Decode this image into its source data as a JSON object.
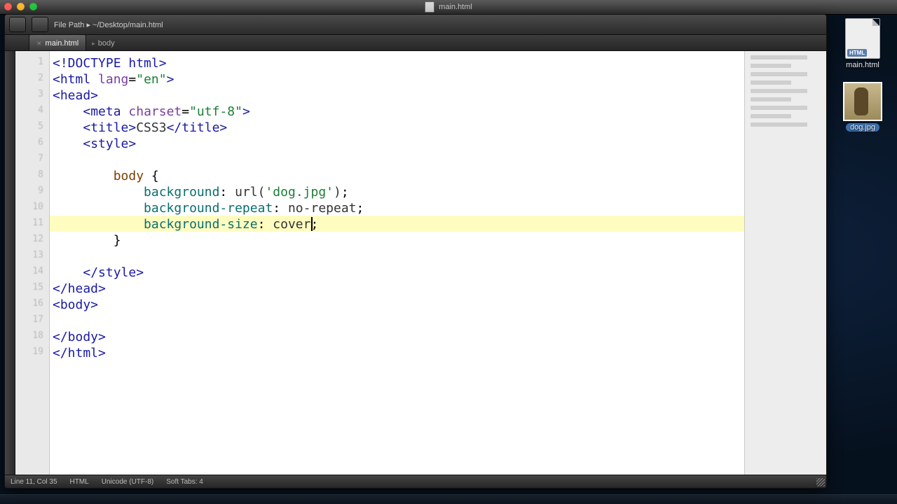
{
  "menubar": {
    "title": "main.html"
  },
  "window": {
    "path": "File Path ▸ ~/Desktop/main.html",
    "tab": "main.html",
    "breadcrumb": "body",
    "status": {
      "line_col": "Line 11, Col 35",
      "mode": "HTML",
      "encoding": "Unicode (UTF-8)",
      "indent": "Soft Tabs: 4"
    }
  },
  "code": {
    "lines": [
      {
        "n": 1,
        "seg": [
          [
            "t-tag",
            "<!DOCTYPE html>"
          ]
        ]
      },
      {
        "n": 2,
        "seg": [
          [
            "t-tag",
            "<html "
          ],
          [
            "t-attr",
            "lang"
          ],
          [
            "t-punct",
            "="
          ],
          [
            "t-str",
            "\"en\""
          ],
          [
            "t-tag",
            ">"
          ]
        ]
      },
      {
        "n": 3,
        "seg": [
          [
            "t-tag",
            "<head>"
          ]
        ]
      },
      {
        "n": 4,
        "indent": 1,
        "seg": [
          [
            "t-tag",
            "<meta "
          ],
          [
            "t-attr",
            "charset"
          ],
          [
            "t-punct",
            "="
          ],
          [
            "t-str",
            "\"utf-8\""
          ],
          [
            "t-tag",
            ">"
          ]
        ]
      },
      {
        "n": 5,
        "indent": 1,
        "seg": [
          [
            "t-tag",
            "<title>"
          ],
          [
            "t-val",
            "CSS3"
          ],
          [
            "t-tag",
            "</title>"
          ]
        ]
      },
      {
        "n": 6,
        "indent": 1,
        "seg": [
          [
            "t-tag",
            "<style>"
          ]
        ]
      },
      {
        "n": 7,
        "blank": true
      },
      {
        "n": 8,
        "indent": 2,
        "seg": [
          [
            "t-sel",
            "body "
          ],
          [
            "t-punct",
            "{"
          ]
        ]
      },
      {
        "n": 9,
        "indent": 3,
        "seg": [
          [
            "t-prop",
            "background"
          ],
          [
            "t-punct",
            ": "
          ],
          [
            "t-val",
            "url("
          ],
          [
            "t-str",
            "'dog.jpg'"
          ],
          [
            "t-val",
            ")"
          ],
          [
            "t-punct",
            ";"
          ]
        ]
      },
      {
        "n": 10,
        "indent": 3,
        "seg": [
          [
            "t-prop",
            "background-repeat"
          ],
          [
            "t-punct",
            ": "
          ],
          [
            "t-val",
            "no-repeat"
          ],
          [
            "t-punct",
            ";"
          ]
        ]
      },
      {
        "n": 11,
        "indent": 3,
        "hl": true,
        "caret_after": "cover",
        "seg": [
          [
            "t-prop",
            "background-size"
          ],
          [
            "t-punct",
            ": "
          ],
          [
            "t-val",
            "cover"
          ],
          [
            "t-punct",
            ";"
          ]
        ]
      },
      {
        "n": 12,
        "indent": 2,
        "seg": [
          [
            "t-punct",
            "}"
          ]
        ]
      },
      {
        "n": 13,
        "blank": true
      },
      {
        "n": 14,
        "indent": 1,
        "seg": [
          [
            "t-tag",
            "</style>"
          ]
        ]
      },
      {
        "n": 15,
        "seg": [
          [
            "t-tag",
            "</head>"
          ]
        ]
      },
      {
        "n": 16,
        "seg": [
          [
            "t-tag",
            "<body>"
          ]
        ]
      },
      {
        "n": 17,
        "blank": true
      },
      {
        "n": 18,
        "seg": [
          [
            "t-tag",
            "</body>"
          ]
        ]
      },
      {
        "n": 19,
        "seg": [
          [
            "t-tag",
            "</html>"
          ]
        ]
      }
    ]
  },
  "desktop": {
    "file": {
      "name": "main.html",
      "badge": "HTML"
    },
    "image": {
      "name": "dog.jpg"
    }
  }
}
